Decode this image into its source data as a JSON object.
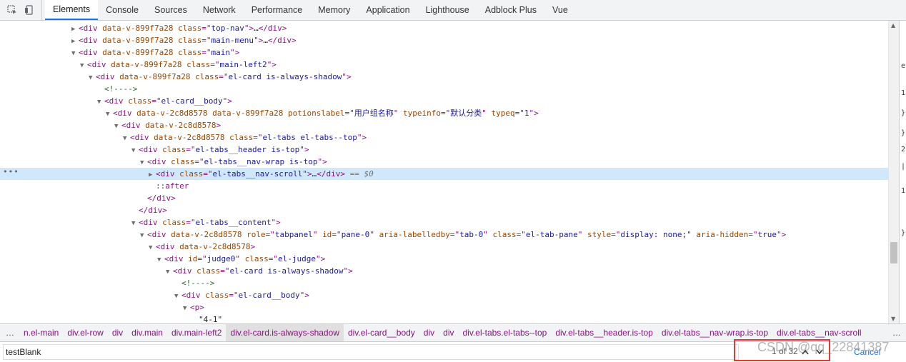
{
  "tabs": [
    "Elements",
    "Console",
    "Sources",
    "Network",
    "Performance",
    "Memory",
    "Application",
    "Lighthouse",
    "Adblock Plus",
    "Vue"
  ],
  "tree_lines": [
    {
      "indent": 0,
      "tri": "▶",
      "parts": [
        [
          "tag",
          "<div "
        ],
        [
          "attr",
          "data-v-899f7a28 class"
        ],
        [
          "tag",
          "=\""
        ],
        [
          "val",
          "top-nav"
        ],
        [
          "tag",
          "\">"
        ],
        [
          "txt",
          "…"
        ],
        [
          "tag",
          "</div>"
        ]
      ]
    },
    {
      "indent": 0,
      "tri": "▶",
      "parts": [
        [
          "tag",
          "<div "
        ],
        [
          "attr",
          "data-v-899f7a28 class"
        ],
        [
          "tag",
          "=\""
        ],
        [
          "val",
          "main-menu"
        ],
        [
          "tag",
          "\">"
        ],
        [
          "txt",
          "…"
        ],
        [
          "tag",
          "</div>"
        ]
      ]
    },
    {
      "indent": 0,
      "tri": "▼",
      "parts": [
        [
          "tag",
          "<div "
        ],
        [
          "attr",
          "data-v-899f7a28 class"
        ],
        [
          "tag",
          "=\""
        ],
        [
          "val",
          "main"
        ],
        [
          "tag",
          "\">"
        ]
      ]
    },
    {
      "indent": 1,
      "tri": "▼",
      "parts": [
        [
          "tag",
          "<div "
        ],
        [
          "attr",
          "data-v-899f7a28 class"
        ],
        [
          "tag",
          "=\""
        ],
        [
          "val",
          "main-left2"
        ],
        [
          "tag",
          "\">"
        ]
      ]
    },
    {
      "indent": 2,
      "tri": "▼",
      "parts": [
        [
          "tag",
          "<div "
        ],
        [
          "attr",
          "data-v-899f7a28 class"
        ],
        [
          "tag",
          "=\""
        ],
        [
          "val",
          "el-card is-always-shadow"
        ],
        [
          "tag",
          "\">"
        ]
      ]
    },
    {
      "indent": 3,
      "tri": "",
      "parts": [
        [
          "cmt",
          "<!---->"
        ]
      ]
    },
    {
      "indent": 3,
      "tri": "▼",
      "parts": [
        [
          "tag",
          "<div "
        ],
        [
          "attr",
          "class"
        ],
        [
          "tag",
          "=\""
        ],
        [
          "val",
          "el-card__body"
        ],
        [
          "tag",
          "\">"
        ]
      ]
    },
    {
      "indent": 4,
      "tri": "▼",
      "parts": [
        [
          "tag",
          "<div "
        ],
        [
          "attr",
          "data-v-2c8d8578 data-v-899f7a28 potionslabel"
        ],
        [
          "tag",
          "=\""
        ],
        [
          "val",
          "用户组名称"
        ],
        [
          "tag",
          "\" "
        ],
        [
          "attr",
          "typeinfo"
        ],
        [
          "tag",
          "=\""
        ],
        [
          "val",
          "默认分类"
        ],
        [
          "tag",
          "\" "
        ],
        [
          "attr",
          "typeq"
        ],
        [
          "tag",
          "=\""
        ],
        [
          "val",
          "1"
        ],
        [
          "tag",
          "\">"
        ]
      ]
    },
    {
      "indent": 5,
      "tri": "▼",
      "parts": [
        [
          "tag",
          "<div "
        ],
        [
          "attr",
          "data-v-2c8d8578"
        ],
        [
          "tag",
          ">"
        ]
      ]
    },
    {
      "indent": 6,
      "tri": "▼",
      "parts": [
        [
          "tag",
          "<div "
        ],
        [
          "attr",
          "data-v-2c8d8578 class"
        ],
        [
          "tag",
          "=\""
        ],
        [
          "val",
          "el-tabs el-tabs--top"
        ],
        [
          "tag",
          "\">"
        ]
      ]
    },
    {
      "indent": 7,
      "tri": "▼",
      "parts": [
        [
          "tag",
          "<div "
        ],
        [
          "attr",
          "class"
        ],
        [
          "tag",
          "=\""
        ],
        [
          "val",
          "el-tabs__header is-top"
        ],
        [
          "tag",
          "\">"
        ]
      ]
    },
    {
      "indent": 8,
      "tri": "▼",
      "parts": [
        [
          "tag",
          "<div "
        ],
        [
          "attr",
          "class"
        ],
        [
          "tag",
          "=\""
        ],
        [
          "val",
          "el-tabs__nav-wrap is-top"
        ],
        [
          "tag",
          "\">"
        ]
      ]
    },
    {
      "indent": 9,
      "tri": "▶",
      "sel": true,
      "parts": [
        [
          "tag",
          "<div "
        ],
        [
          "attr",
          "class"
        ],
        [
          "tag",
          "=\""
        ],
        [
          "val",
          "el-tabs__nav-scroll"
        ],
        [
          "tag",
          "\">"
        ],
        [
          "txt",
          "…"
        ],
        [
          "tag",
          "</div>"
        ],
        [
          "dollar",
          " == $0"
        ]
      ]
    },
    {
      "indent": 9,
      "tri": "",
      "parts": [
        [
          "pseudo",
          "::after"
        ]
      ]
    },
    {
      "indent": 8,
      "tri": "",
      "parts": [
        [
          "tag",
          "</div>"
        ]
      ]
    },
    {
      "indent": 7,
      "tri": "",
      "parts": [
        [
          "tag",
          "</div>"
        ]
      ]
    },
    {
      "indent": 7,
      "tri": "▼",
      "parts": [
        [
          "tag",
          "<div "
        ],
        [
          "attr",
          "class"
        ],
        [
          "tag",
          "=\""
        ],
        [
          "val",
          "el-tabs__content"
        ],
        [
          "tag",
          "\">"
        ]
      ]
    },
    {
      "indent": 8,
      "tri": "▼",
      "parts": [
        [
          "tag",
          "<div "
        ],
        [
          "attr",
          "data-v-2c8d8578 role"
        ],
        [
          "tag",
          "=\""
        ],
        [
          "val",
          "tabpanel"
        ],
        [
          "tag",
          "\" "
        ],
        [
          "attr",
          "id"
        ],
        [
          "tag",
          "=\""
        ],
        [
          "val",
          "pane-0"
        ],
        [
          "tag",
          "\" "
        ],
        [
          "attr",
          "aria-labelledby"
        ],
        [
          "tag",
          "=\""
        ],
        [
          "val",
          "tab-0"
        ],
        [
          "tag",
          "\" "
        ],
        [
          "attr",
          "class"
        ],
        [
          "tag",
          "=\""
        ],
        [
          "val",
          "el-tab-pane"
        ],
        [
          "tag",
          "\" "
        ],
        [
          "attr",
          "style"
        ],
        [
          "tag",
          "=\""
        ],
        [
          "val",
          "display: none;"
        ],
        [
          "tag",
          "\" "
        ],
        [
          "attr",
          "aria-hidden"
        ],
        [
          "tag",
          "=\""
        ],
        [
          "val",
          "true"
        ],
        [
          "tag",
          "\">"
        ]
      ]
    },
    {
      "indent": 9,
      "tri": "▼",
      "parts": [
        [
          "tag",
          "<div "
        ],
        [
          "attr",
          "data-v-2c8d8578"
        ],
        [
          "tag",
          ">"
        ]
      ]
    },
    {
      "indent": 10,
      "tri": "▼",
      "parts": [
        [
          "tag",
          "<div "
        ],
        [
          "attr",
          "id"
        ],
        [
          "tag",
          "=\""
        ],
        [
          "val",
          "judge0"
        ],
        [
          "tag",
          "\" "
        ],
        [
          "attr",
          "class"
        ],
        [
          "tag",
          "=\""
        ],
        [
          "val",
          "el-judge"
        ],
        [
          "tag",
          "\">"
        ]
      ]
    },
    {
      "indent": 11,
      "tri": "▼",
      "parts": [
        [
          "tag",
          "<div "
        ],
        [
          "attr",
          "class"
        ],
        [
          "tag",
          "=\""
        ],
        [
          "val",
          "el-card is-always-shadow"
        ],
        [
          "tag",
          "\">"
        ]
      ]
    },
    {
      "indent": 12,
      "tri": "",
      "parts": [
        [
          "cmt",
          "<!---->"
        ]
      ]
    },
    {
      "indent": 12,
      "tri": "▼",
      "parts": [
        [
          "tag",
          "<div "
        ],
        [
          "attr",
          "class"
        ],
        [
          "tag",
          "=\""
        ],
        [
          "val",
          "el-card__body"
        ],
        [
          "tag",
          "\">"
        ]
      ]
    },
    {
      "indent": 13,
      "tri": "▼",
      "parts": [
        [
          "tag",
          "<p>"
        ]
      ]
    },
    {
      "indent": 14,
      "tri": "",
      "parts": [
        [
          "txt",
          "\"4-1\""
        ]
      ]
    }
  ],
  "breadcrumbs": [
    "n.el-main",
    "div.el-row",
    "div",
    "div.main",
    "div.main-left2",
    "div.el-card.is-always-shadow",
    "div.el-card__body",
    "div",
    "div",
    "div.el-tabs.el-tabs--top",
    "div.el-tabs__header.is-top",
    "div.el-tabs__nav-wrap.is-top",
    "div.el-tabs__nav-scroll"
  ],
  "breadcrumb_active_index": 5,
  "search": {
    "value": "testBlank",
    "match_count": "1 of 32",
    "cancel_label": "Cancel"
  },
  "watermark": "CSDN @qq_22841387",
  "right_pane_chars": [
    "e",
    "1",
    "}",
    "}",
    "2",
    "|",
    "1",
    "}"
  ],
  "colors": {
    "accent": "#1a73e8",
    "highlight": "#e53935",
    "selected_row": "#cfe8fc"
  }
}
